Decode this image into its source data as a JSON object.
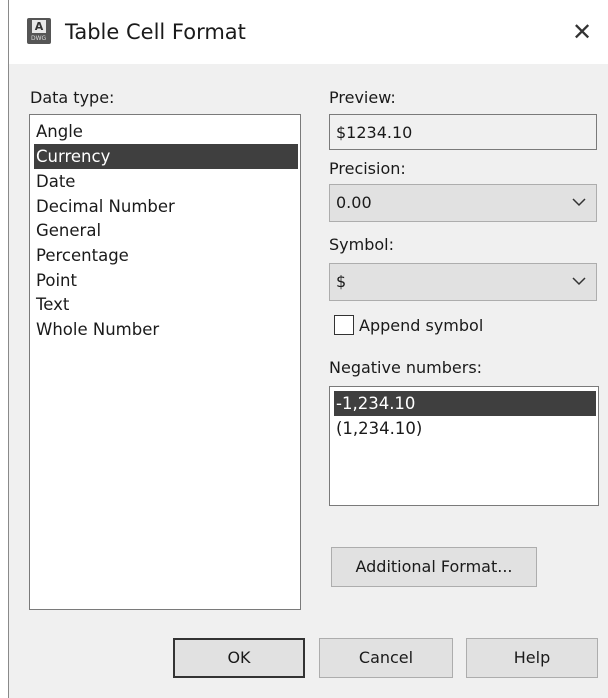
{
  "window": {
    "title": "Table Cell Format",
    "icon": "autocad-app-icon",
    "close_glyph": "✕"
  },
  "data_type": {
    "label": "Data type:",
    "items": [
      "Angle",
      "Currency",
      "Date",
      "Decimal Number",
      "General",
      "Percentage",
      "Point",
      "Text",
      "Whole Number"
    ],
    "selected": "Currency"
  },
  "preview": {
    "label": "Preview:",
    "value": "$1234.10"
  },
  "precision": {
    "label": "Precision:",
    "value": "0.00"
  },
  "symbol": {
    "label": "Symbol:",
    "value": "$"
  },
  "append_symbol": {
    "label": "Append symbol",
    "checked": false
  },
  "negative_numbers": {
    "label": "Negative numbers:",
    "items": [
      "-1,234.10",
      "(1,234.10)"
    ],
    "selected": "-1,234.10"
  },
  "buttons": {
    "additional_format": "Additional Format...",
    "ok": "OK",
    "cancel": "Cancel",
    "help": "Help"
  },
  "colors": {
    "dialog_bg": "#f0f0f0",
    "selection_bg": "#3f3f3f",
    "selection_text": "#ffffff"
  }
}
